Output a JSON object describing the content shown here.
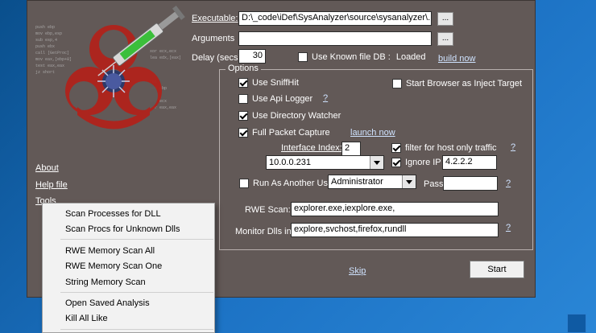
{
  "executable": {
    "label": "Executable:",
    "value": "D:\\_code\\iDef\\SysAnalyzer\\source\\sysanalyzer\\..\\..\\",
    "browse": "..."
  },
  "arguments": {
    "label": "Arguments",
    "value": "",
    "browse": "..."
  },
  "delay": {
    "label": "Delay (secs)",
    "value": "30"
  },
  "known_db": {
    "label": "Use Known file DB :",
    "status": "Loaded",
    "build_link": "build now"
  },
  "options": {
    "title": "Options",
    "use_sniffhit": "Use SniffHit",
    "start_browser": "Start Browser as Inject Target",
    "use_api_logger": "Use Api Logger",
    "api_help": "?",
    "use_dir_watcher": "Use Directory Watcher",
    "full_packet": "Full Packet Capture",
    "launch_now": "launch now",
    "interface_label": "Interface Index:",
    "interface_value": "2",
    "filter_host": "filter for host only traffic",
    "filter_help": "?",
    "ip_value": "10.0.0.231",
    "ignore_ip": "Ignore IP",
    "ignore_ip_value": "4.2.2.2",
    "run_as_user": "Run As Another User",
    "user_value": "Administrator",
    "pass_label": "Pass",
    "pass_value": "",
    "pass_help": "?",
    "rwe_label": "RWE Scan:",
    "rwe_value": "explorer.exe,iexplore.exe,",
    "monitor_label": "Monitor Dlls in:",
    "monitor_value": "explore,svchost,firefox,rundll",
    "monitor_help": "?"
  },
  "left_links": {
    "about": "About",
    "help": "Help file",
    "tools": "Tools"
  },
  "actions": {
    "skip": "Skip",
    "start": "Start"
  },
  "tools_menu": {
    "items": [
      "Scan Processes for DLL",
      "Scan Procs for Unknown Dlls",
      "RWE Memory Scan All",
      "RWE Memory Scan One",
      "String Memory Scan",
      "Open Saved Analysis",
      "Kill All Like"
    ]
  },
  "logo": {
    "code_lines": [
      "push ebp",
      "mov ebp,esp",
      "sub esp,4",
      "push ebx",
      "call [GetProc]",
      "mov eax,[ebp+8]",
      "test eax,eax",
      "jz short",
      "xor ecx,ecx",
      "lea edx,[eax]",
      "ret",
      "pop ebp",
      "inc ecx",
      "xor eax,eax"
    ]
  },
  "colors": {
    "window_bg": "#625957",
    "desktop": "#1c72c4",
    "biohazard": "#b0231c",
    "syringe": "#3bbf3b"
  }
}
